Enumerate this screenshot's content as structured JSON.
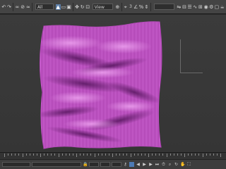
{
  "toolbar": {
    "selection_filter": "All",
    "coordinate_system": "View",
    "angle_snap_label": "3",
    "named_selection": "",
    "icons": [
      "undo-icon",
      "redo-icon",
      "link-icon",
      "unlink-icon",
      "bind-icon",
      "select-icon",
      "select-region-icon",
      "window-crossing-icon",
      "move-icon",
      "rotate-icon",
      "scale-icon",
      "pivot-icon",
      "snap-icon",
      "angle-snap-icon",
      "percent-snap-icon",
      "spinner-snap-icon",
      "mirror-icon",
      "align-icon",
      "layer-icon",
      "curve-editor-icon",
      "schematic-icon",
      "material-editor-icon",
      "render-setup-icon",
      "rendered-frame-icon",
      "render-icon"
    ]
  },
  "viewport": {
    "object_color": "#cc5fcf",
    "object_dark": "#6a1f70",
    "object_highlight": "#f3a0f5"
  },
  "statusbar": {
    "add_time_tag": "Add Time Tag",
    "auto_key": "",
    "icons": [
      "lock-icon",
      "key-icon",
      "prev-frame-icon",
      "play-icon",
      "next-frame-icon",
      "end-frame-icon",
      "time-config-icon",
      "zoom-icon",
      "orbit-icon",
      "pan-icon",
      "maximize-icon"
    ]
  }
}
